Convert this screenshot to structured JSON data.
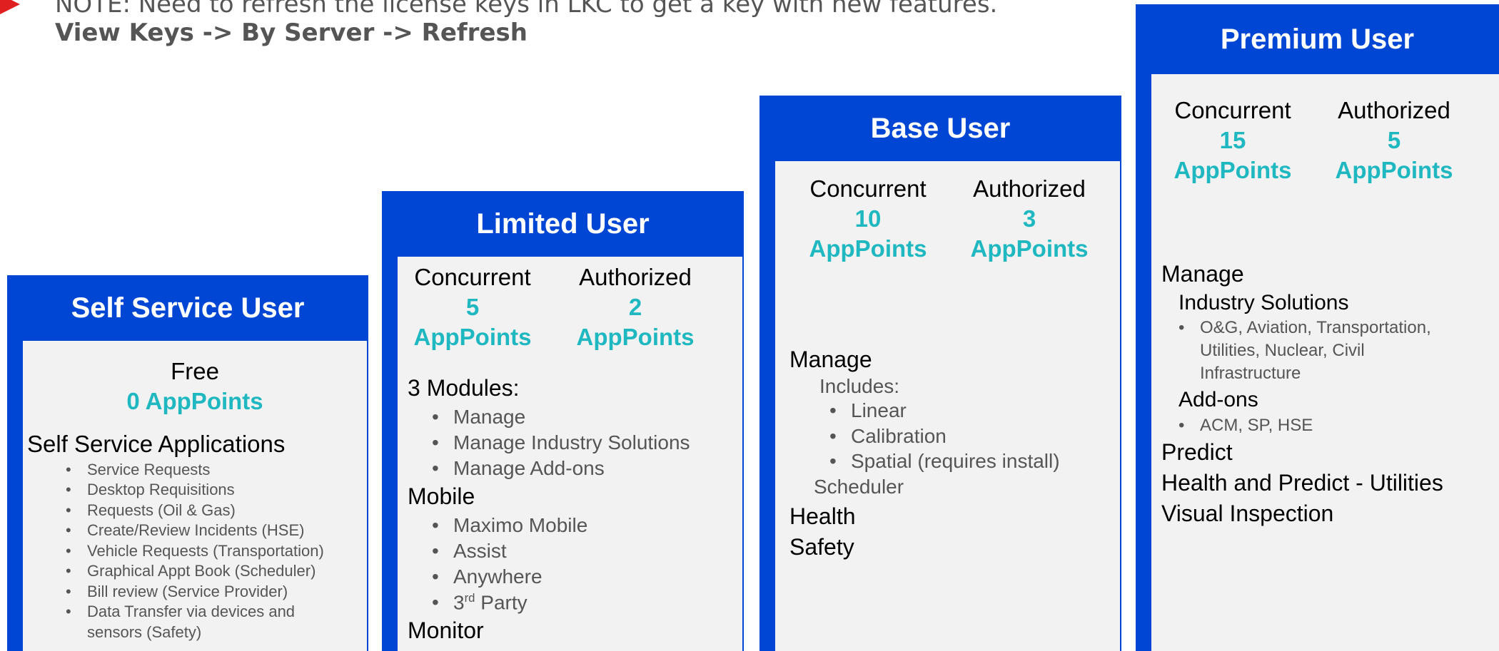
{
  "note": {
    "line1": "NOTE: Need to refresh the license keys in LKC to get a key with new features.",
    "line2": "View Keys -> By Server -> Refresh"
  },
  "cards": {
    "self_service": {
      "title": "Self Service User",
      "free": "Free",
      "points": "0 AppPoints",
      "section": "Self Service Applications",
      "items": [
        "Service Requests",
        "Desktop Requisitions",
        "Requests (Oil & Gas)",
        "Create/Review Incidents (HSE)",
        "Vehicle Requests (Transportation)",
        "Graphical Appt Book (Scheduler)",
        "Bill review (Service Provider)",
        "Data Transfer via devices and",
        "sensors (Safety)"
      ]
    },
    "limited": {
      "title": "Limited User",
      "concurrent_label": "Concurrent",
      "concurrent_value": "5",
      "authorized_label": "Authorized",
      "authorized_value": "2",
      "unit": "AppPoints",
      "modules_heading": "3 Modules:",
      "modules": [
        "Manage",
        "Manage Industry Solutions",
        "Manage Add-ons"
      ],
      "mobile_heading": "Mobile",
      "mobile_items": [
        "Maximo Mobile",
        "Assist",
        "Anywhere"
      ],
      "third_party_prefix": "3",
      "third_party_sup": "rd",
      "third_party_suffix": " Party",
      "monitor": "Monitor"
    },
    "base": {
      "title": "Base User",
      "concurrent_label": "Concurrent",
      "concurrent_value": "10",
      "authorized_label": "Authorized",
      "authorized_value": "3",
      "unit": "AppPoints",
      "manage": "Manage",
      "includes": "Includes:",
      "includes_items": [
        "Linear",
        "Calibration",
        "Spatial (requires install)"
      ],
      "scheduler": "Scheduler",
      "health": "Health",
      "safety": "Safety"
    },
    "premium": {
      "title": "Premium User",
      "concurrent_label": "Concurrent",
      "concurrent_value": "15",
      "authorized_label": "Authorized",
      "authorized_value": "5",
      "unit": "AppPoints",
      "manage": "Manage",
      "industry": "Industry Solutions",
      "industry_lines": [
        "O&G, Aviation, Transportation,",
        "Utilities, Nuclear, Civil",
        "Infrastructure"
      ],
      "addons": "Add-ons",
      "addons_items": [
        "ACM, SP, HSE"
      ],
      "predict": "Predict",
      "health_predict": "Health and Predict - Utilities",
      "visual": "Visual Inspection"
    }
  },
  "colors": {
    "header_blue": "#0046d5",
    "accent_teal": "#1fb8c0",
    "panel_gray": "#f2f2f2",
    "note_arrow": "#e02020"
  }
}
